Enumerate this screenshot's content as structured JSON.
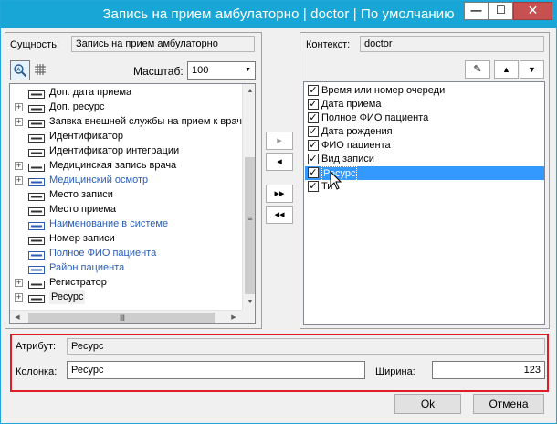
{
  "window": {
    "title": "Запись на прием амбулаторно | doctor | По умолчанию",
    "minimize_glyph": "—",
    "maximize_glyph": "☐",
    "close_glyph": "✕"
  },
  "left_panel": {
    "entity_label": "Сущность:",
    "entity_value": "Запись на прием амбулаторно",
    "scale_label": "Масштаб:",
    "scale_value": "100",
    "tree_items": [
      {
        "label": "Доп. дата приема",
        "expandable": false,
        "style": "normal"
      },
      {
        "label": "Доп. ресурс",
        "expandable": true,
        "style": "normal"
      },
      {
        "label": "Заявка внешней службы на прием к врача",
        "expandable": true,
        "style": "normal"
      },
      {
        "label": "Идентификатор",
        "expandable": false,
        "style": "normal"
      },
      {
        "label": "Идентификатор интеграции",
        "expandable": false,
        "style": "normal"
      },
      {
        "label": "Медицинская запись врача",
        "expandable": true,
        "style": "normal"
      },
      {
        "label": "Медицинский осмотр",
        "expandable": true,
        "style": "blue"
      },
      {
        "label": "Место записи",
        "expandable": false,
        "style": "normal"
      },
      {
        "label": "Место приема",
        "expandable": false,
        "style": "normal"
      },
      {
        "label": "Наименование в системе",
        "expandable": false,
        "style": "blue"
      },
      {
        "label": "Номер записи",
        "expandable": false,
        "style": "normal"
      },
      {
        "label": "Полное ФИО пациента",
        "expandable": false,
        "style": "blue"
      },
      {
        "label": "Район пациента",
        "expandable": false,
        "style": "blue"
      },
      {
        "label": "Регистратор",
        "expandable": true,
        "style": "normal"
      },
      {
        "label": "Ресурс",
        "expandable": true,
        "style": "selected"
      }
    ]
  },
  "middle_buttons": {
    "add_one": "▸",
    "remove_one": "◂",
    "add_all": "▸▸",
    "remove_all": "◂◂"
  },
  "right_panel": {
    "context_label": "Контекст:",
    "context_value": "doctor",
    "edit_icon": "✎",
    "up_glyph": "▲",
    "down_glyph": "▼",
    "columns": [
      {
        "label": "Время или номер очереди",
        "checked": true,
        "selected": false
      },
      {
        "label": "Дата приема",
        "checked": true,
        "selected": false
      },
      {
        "label": "Полное ФИО пациента",
        "checked": true,
        "selected": false
      },
      {
        "label": "Дата рождения",
        "checked": true,
        "selected": false
      },
      {
        "label": "ФИО пациента",
        "checked": true,
        "selected": false
      },
      {
        "label": "Вид записи",
        "checked": true,
        "selected": false
      },
      {
        "label": "Ресурс",
        "checked": true,
        "selected": true
      },
      {
        "label": "Ти",
        "checked": true,
        "selected": false
      }
    ]
  },
  "attribute_panel": {
    "attribute_label": "Атрибут:",
    "attribute_value": "Ресурс",
    "column_label": "Колонка:",
    "column_value": "Ресурс",
    "width_label": "Ширина:",
    "width_value": "123"
  },
  "buttons": {
    "ok": "Ok",
    "cancel": "Отмена"
  },
  "colors": {
    "titlebar": "#18a6d7",
    "selection": "#3399ff",
    "highlight_border": "#e01c24",
    "link_blue": "#2a5db8"
  }
}
